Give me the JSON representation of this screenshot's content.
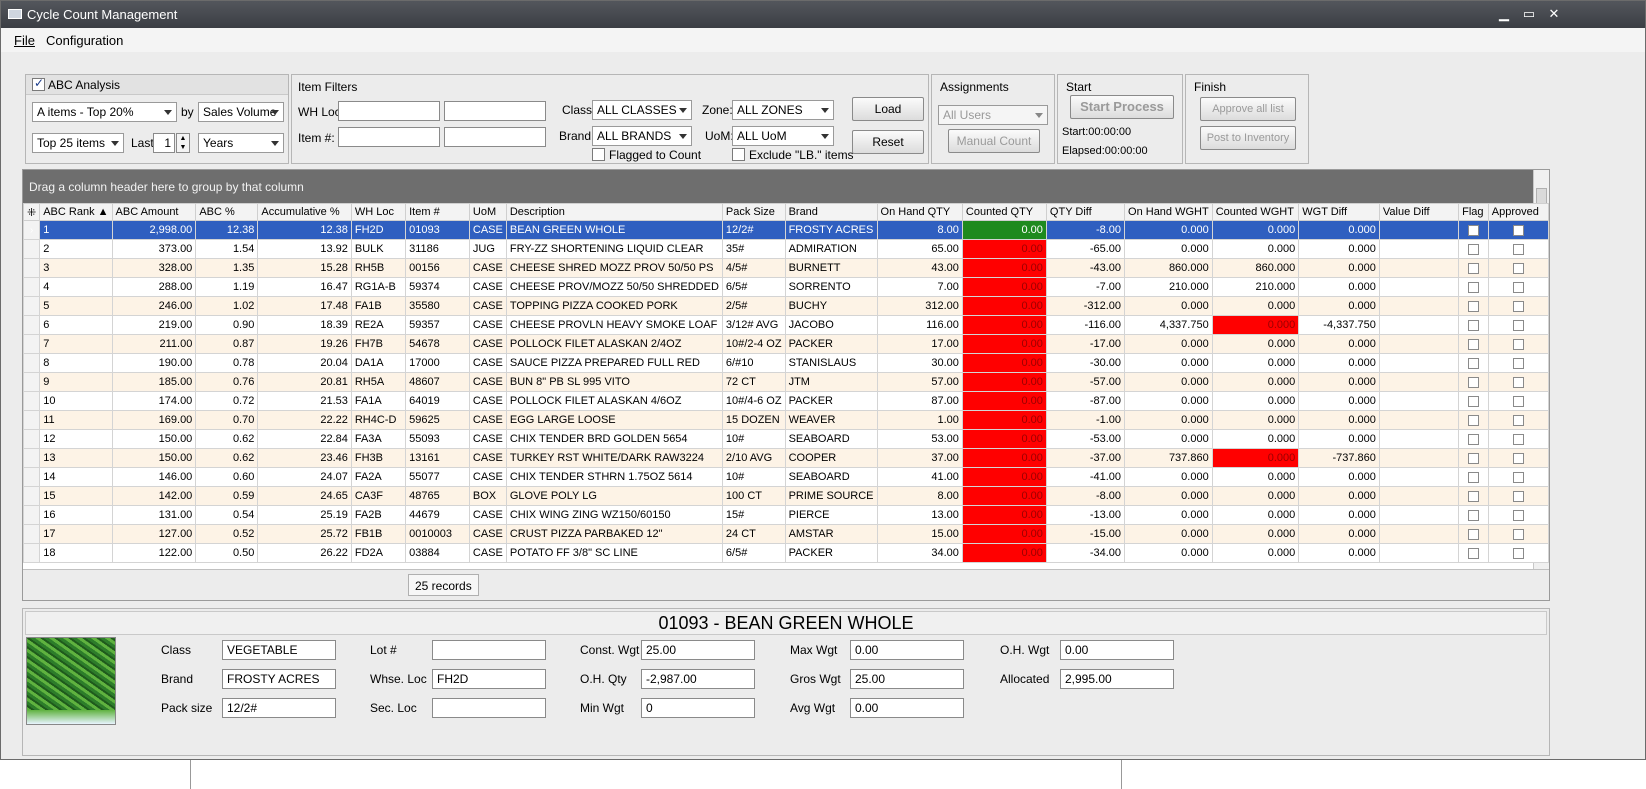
{
  "window": {
    "title": "Cycle Count Management",
    "min": "▁",
    "max": "▭",
    "close": "✕"
  },
  "menu": {
    "file": "File",
    "configuration": "Configuration"
  },
  "abc": {
    "header": "ABC Analysis",
    "checked": true,
    "items_combo": "A items - Top 20%",
    "by_label": "by",
    "by_combo": "Sales Volume",
    "top_combo": "Top 25 items",
    "last_label": "Last",
    "last_value": "1",
    "period_combo": "Years"
  },
  "filters": {
    "header": "Item Filters",
    "whloc_label": "WH Loc:",
    "item_label": "Item #:",
    "class_label": "Class:",
    "class_value": "ALL CLASSES",
    "zone_label": "Zone:",
    "zone_value": "ALL ZONES",
    "brand_label": "Brand:",
    "brand_value": "ALL BRANDS",
    "uom_label": "UoM:",
    "uom_value": "ALL UoM",
    "flagged_label": "Flagged to Count",
    "exclude_label": "Exclude \"LB.\" items",
    "load": "Load",
    "reset": "Reset"
  },
  "assignments": {
    "header": "Assignments",
    "users": "All Users",
    "manual": "Manual Count"
  },
  "start": {
    "header": "Start",
    "button": "Start Process",
    "start_text": "Start:00:00:00",
    "elapsed_text": "Elapsed:00:00:00"
  },
  "finish": {
    "header": "Finish",
    "approve": "Approve all list",
    "post": "Post to Inventory"
  },
  "grid": {
    "group_hint": "Drag a column header here to group by that column",
    "columns": [
      "ABC Rank ▲",
      "ABC Amount",
      "ABC %",
      "Accumulative %",
      "WH Loc",
      "Item #",
      "UoM",
      "Description",
      "Pack Size",
      "Brand",
      "On Hand QTY",
      "Counted QTY",
      "QTY Diff",
      "On Hand WGHT",
      "Counted WGHT",
      "WGT Diff",
      "Value Diff",
      "Flag",
      "Approved"
    ],
    "rows": [
      [
        "1",
        "2,998.00",
        "12.38",
        "12.38",
        "FH2D",
        "01093",
        "CASE",
        "BEAN GREEN WHOLE",
        "12/2#",
        "FROSTY ACRES",
        "8.00",
        "0.00",
        "-8.00",
        "0.000",
        "0.000",
        "0.000",
        ""
      ],
      [
        "2",
        "373.00",
        "1.54",
        "13.92",
        "BULK",
        "31186",
        "JUG",
        "FRY-ZZ SHORTENING LIQUID CLEAR",
        "35#",
        "ADMIRATION",
        "65.00",
        "0.00",
        "-65.00",
        "0.000",
        "0.000",
        "0.000",
        ""
      ],
      [
        "3",
        "328.00",
        "1.35",
        "15.28",
        "RH5B",
        "00156",
        "CASE",
        "CHEESE SHRED MOZZ PROV 50/50 PS",
        "4/5#",
        "BURNETT",
        "43.00",
        "0.00",
        "-43.00",
        "860.000",
        "860.000",
        "0.000",
        ""
      ],
      [
        "4",
        "288.00",
        "1.19",
        "16.47",
        "RG1A-B",
        "59374",
        "CASE",
        "CHEESE PROV/MOZZ 50/50 SHREDDED",
        "6/5#",
        "SORRENTO",
        "7.00",
        "0.00",
        "-7.00",
        "210.000",
        "210.000",
        "0.000",
        ""
      ],
      [
        "5",
        "246.00",
        "1.02",
        "17.48",
        "FA1B",
        "35580",
        "CASE",
        "TOPPING PIZZA COOKED PORK",
        "2/5#",
        "BUCHY",
        "312.00",
        "0.00",
        "-312.00",
        "0.000",
        "0.000",
        "0.000",
        ""
      ],
      [
        "6",
        "219.00",
        "0.90",
        "18.39",
        "RE2A",
        "59357",
        "CASE",
        "CHEESE PROVLN HEAVY SMOKE LOAF",
        "3/12# AVG",
        "JACOBO",
        "116.00",
        "0.00",
        "-116.00",
        "4,337.750",
        "0.000",
        "-4,337.750",
        ""
      ],
      [
        "7",
        "211.00",
        "0.87",
        "19.26",
        "FH7B",
        "54678",
        "CASE",
        "POLLOCK FILET ALASKAN 2/4OZ",
        "10#/2-4 OZ",
        "PACKER",
        "17.00",
        "0.00",
        "-17.00",
        "0.000",
        "0.000",
        "0.000",
        ""
      ],
      [
        "8",
        "190.00",
        "0.78",
        "20.04",
        "DA1A",
        "17000",
        "CASE",
        "SAUCE PIZZA PREPARED FULL RED",
        "6/#10",
        "STANISLAUS",
        "30.00",
        "0.00",
        "-30.00",
        "0.000",
        "0.000",
        "0.000",
        ""
      ],
      [
        "9",
        "185.00",
        "0.76",
        "20.81",
        "RH5A",
        "48607",
        "CASE",
        "BUN 8\" PB SL 995 VITO",
        "72 CT",
        "JTM",
        "57.00",
        "0.00",
        "-57.00",
        "0.000",
        "0.000",
        "0.000",
        ""
      ],
      [
        "10",
        "174.00",
        "0.72",
        "21.53",
        "FA1A",
        "64019",
        "CASE",
        "POLLOCK FILET ALASKAN 4/6OZ",
        "10#/4-6 OZ",
        "PACKER",
        "87.00",
        "0.00",
        "-87.00",
        "0.000",
        "0.000",
        "0.000",
        ""
      ],
      [
        "11",
        "169.00",
        "0.70",
        "22.22",
        "RH4C-D",
        "59625",
        "CASE",
        "EGG LARGE LOOSE",
        "15 DOZEN",
        "WEAVER",
        "1.00",
        "0.00",
        "-1.00",
        "0.000",
        "0.000",
        "0.000",
        ""
      ],
      [
        "12",
        "150.00",
        "0.62",
        "22.84",
        "FA3A",
        "55093",
        "CASE",
        "CHIX TENDER BRD GOLDEN 5654",
        "10#",
        "SEABOARD",
        "53.00",
        "0.00",
        "-53.00",
        "0.000",
        "0.000",
        "0.000",
        ""
      ],
      [
        "13",
        "150.00",
        "0.62",
        "23.46",
        "FH3B",
        "13161",
        "CASE",
        "TURKEY RST WHITE/DARK RAW3224",
        "2/10 AVG",
        "COOPER",
        "37.00",
        "0.00",
        "-37.00",
        "737.860",
        "0.000",
        "-737.860",
        ""
      ],
      [
        "14",
        "146.00",
        "0.60",
        "24.07",
        "FA2A",
        "55077",
        "CASE",
        "CHIX TENDER STHRN 1.75OZ 5614",
        "10#",
        "SEABOARD",
        "41.00",
        "0.00",
        "-41.00",
        "0.000",
        "0.000",
        "0.000",
        ""
      ],
      [
        "15",
        "142.00",
        "0.59",
        "24.65",
        "CA3F",
        "48765",
        "BOX",
        "GLOVE POLY LG",
        "100 CT",
        "PRIME SOURCE",
        "8.00",
        "0.00",
        "-8.00",
        "0.000",
        "0.000",
        "0.000",
        ""
      ],
      [
        "16",
        "131.00",
        "0.54",
        "25.19",
        "FA2B",
        "44679",
        "CASE",
        "CHIX WING ZING  WZ150/60150",
        "15#",
        "PIERCE",
        "13.00",
        "0.00",
        "-13.00",
        "0.000",
        "0.000",
        "0.000",
        ""
      ],
      [
        "17",
        "127.00",
        "0.52",
        "25.72",
        "FB1B",
        "0010003",
        "CASE",
        "CRUST PIZZA PARBAKED 12\"",
        "24 CT",
        "AMSTAR",
        "15.00",
        "0.00",
        "-15.00",
        "0.000",
        "0.000",
        "0.000",
        ""
      ],
      [
        "18",
        "122.00",
        "0.50",
        "26.22",
        "FD2A",
        "03884",
        "CASE",
        "POTATO FF 3/8\" SC LINE",
        "6/5#",
        "PACKER",
        "34.00",
        "0.00",
        "-34.00",
        "0.000",
        "0.000",
        "0.000",
        ""
      ]
    ],
    "records": "25 records"
  },
  "detail": {
    "title": "01093 - BEAN GREEN WHOLE",
    "class_label": "Class",
    "class_value": "VEGETABLE",
    "brand_label": "Brand",
    "brand_value": "FROSTY ACRES",
    "pack_label": "Pack size",
    "pack_value": "12/2#",
    "lot_label": "Lot #",
    "lot_value": "",
    "whse_label": "Whse. Loc",
    "whse_value": "FH2D",
    "sec_label": "Sec. Loc",
    "sec_value": "",
    "const_label": "Const. Wgt",
    "const_value": "25.00",
    "ohqty_label": "O.H. Qty",
    "ohqty_value": "-2,987.00",
    "minwgt_label": "Min Wgt",
    "minwgt_value": "0",
    "maxwgt_label": "Max Wgt",
    "maxwgt_value": "0.00",
    "gros_label": "Gros Wgt",
    "gros_value": "25.00",
    "avg_label": "Avg Wgt",
    "avg_value": "0.00",
    "ohwgt_label": "O.H. Wgt",
    "ohwgt_value": "0.00",
    "alloc_label": "Allocated",
    "alloc_value": "2,995.00"
  },
  "colors": {
    "selected_row": "#2f5fc0",
    "uncounted": "#ff0000",
    "counted": "#1e8a1e",
    "group_bar": "#6e6e6e"
  }
}
